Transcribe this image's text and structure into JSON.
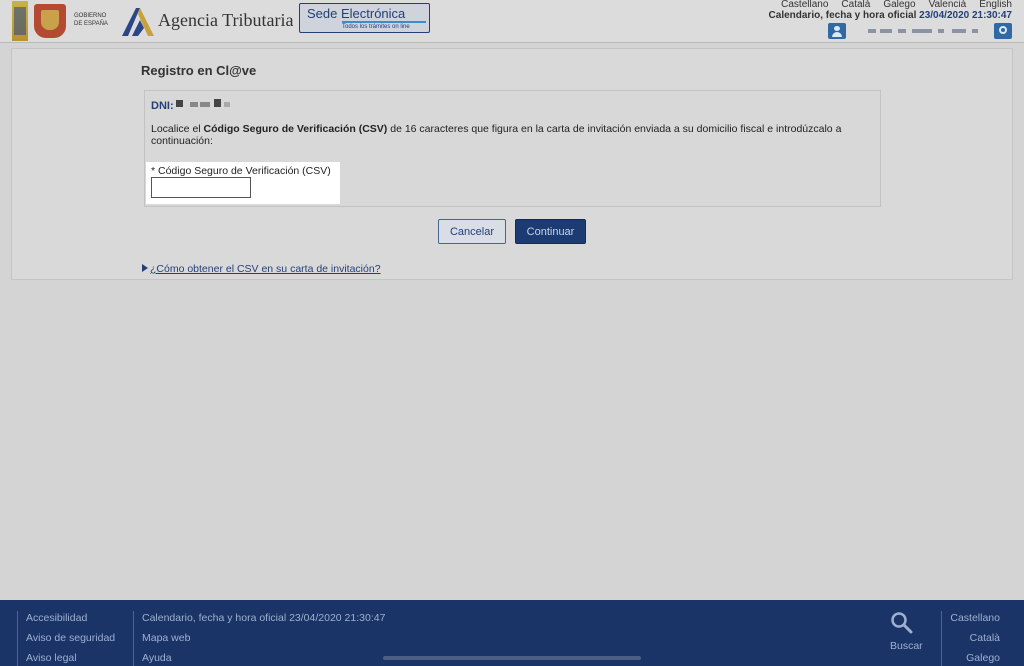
{
  "header": {
    "gov_logo_text": [
      "GOBIERNO",
      "DE ESPAÑA"
    ],
    "agency_name": "Agencia Tributaria",
    "sede_title": "Sede Electrónica",
    "sede_subtitle": "Todos los trámites on line",
    "languages": [
      "Castellano",
      "Català",
      "Galego",
      "Valencià",
      "English"
    ],
    "datetime_label": "Calendario, fecha y hora oficial",
    "datetime_value": "23/04/2020 21:30:47"
  },
  "main": {
    "title": "Registro en Cl@ve",
    "dni_label": "DNI:",
    "instructions": {
      "before": "Localice el ",
      "bold": "Código Seguro de Verificación (CSV)",
      "after": " de 16 caracteres que figura en la carta de invitación enviada a su domicilio fiscal e introdúzcalo a continuación:"
    },
    "csv_field": {
      "label": "* Código Seguro de Verificación (CSV)",
      "value": ""
    },
    "cancel_label": "Cancelar",
    "continue_label": "Continuar",
    "help_link": "¿Cómo obtener el CSV en su carta de invitación?"
  },
  "footer": {
    "col1": [
      "Accesibilidad",
      "Aviso de seguridad",
      "Aviso legal"
    ],
    "col2": [
      "Calendario, fecha y hora oficial 23/04/2020 21:30:47",
      "Mapa web",
      "Ayuda"
    ],
    "search_label": "Buscar",
    "languages": [
      "Castellano",
      "Català",
      "Galego"
    ]
  },
  "colors": {
    "brand_blue": "#1a3468",
    "link_blue": "#233f7a",
    "footer_text": "#9fb0cf"
  }
}
